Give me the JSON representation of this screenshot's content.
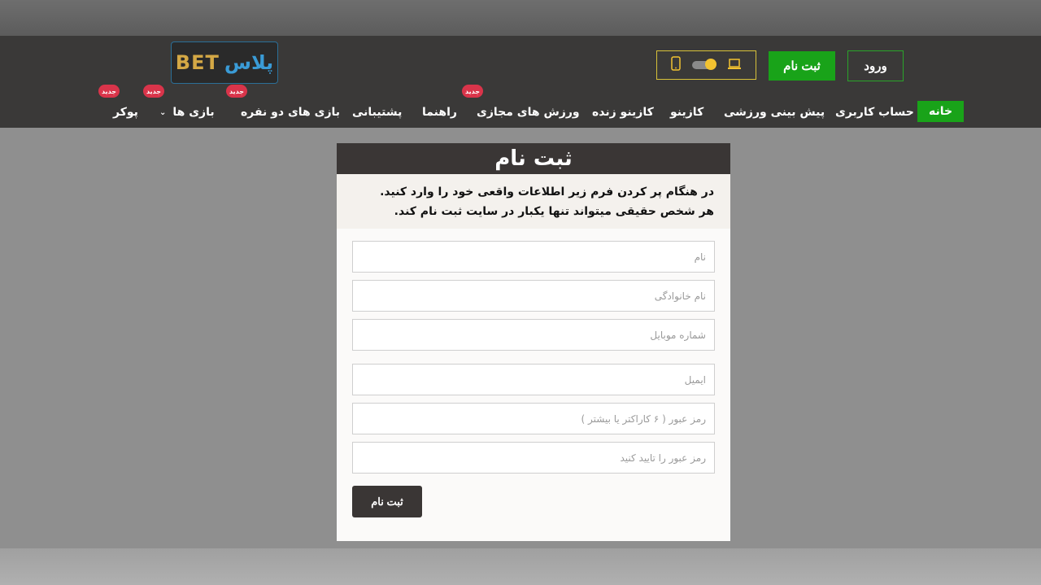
{
  "header": {
    "login_label": "ورود",
    "register_label": "ثبت نام",
    "logo_text_latin": "BET",
    "logo_text_persian": "پلاس"
  },
  "nav": {
    "items": [
      {
        "label": "خانه",
        "active": true
      },
      {
        "label": "حساب کاربری"
      },
      {
        "label": "پیش بینی ورزشی"
      },
      {
        "label": "کازینو"
      },
      {
        "label": "کازینو زنده"
      },
      {
        "label": "ورزش های مجازی",
        "badge": "جدید"
      },
      {
        "label": "راهنما"
      },
      {
        "label": "پشتیبانی"
      },
      {
        "label": "بازی های دو نفره",
        "badge": "جدید"
      },
      {
        "label": "بازی ها",
        "badge": "جدید",
        "dropdown": true
      },
      {
        "label": "پوکر",
        "badge": "جدید"
      }
    ]
  },
  "form": {
    "title": "ثبت نام",
    "intro_line1": "در هنگام پر کردن فرم زیر اطلاعات واقعی خود را وارد کنید.",
    "intro_line2": "هر شخص حقیقی میتواند تنها یکبار در سایت ثبت نام کند.",
    "fields": {
      "first_name": "نام",
      "last_name": "نام خانوادگی",
      "mobile": "شماره موبایل",
      "email": "ایمیل",
      "password": "رمز عبور ( ۶ کاراکتر یا بیشتر )",
      "password_confirm": "رمز عبور را تایید کنید"
    },
    "submit_label": "ثبت نام"
  },
  "colors": {
    "header_bg": "#3a3938",
    "accent_green": "#19a319",
    "badge_red": "#d9344a",
    "toggle_border": "#d8c23a"
  }
}
